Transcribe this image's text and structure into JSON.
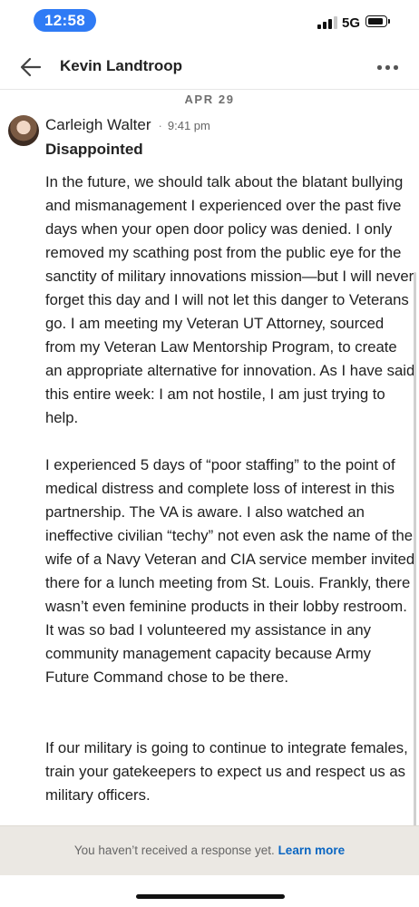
{
  "status_bar": {
    "time": "12:58",
    "network": "5G",
    "signal_bars_active": 3,
    "signal_bars_total": 4,
    "battery_level_fraction": 0.8
  },
  "header": {
    "back_icon": "arrow-left-icon",
    "title": "Kevin Landtroop",
    "more_icon": "more-horizontal-icon"
  },
  "date_divider": "APR 29",
  "message": {
    "sender": "Carleigh Walter",
    "separator": "·",
    "time": "9:41 pm",
    "subject": "Disappointed",
    "paragraphs": [
      "In the future, we should talk about the blatant bullying and mismanagement I experienced over the past five days when your open door policy was denied. I only removed my scathing post from the public eye for the sanctity of military innovations mission—but I will never forget this day and I will not let this danger to Veterans go. I am meeting my Veteran UT Attorney, sourced from my Veteran Law Mentorship Program, to create an appropriate alternative for innovation. As I have said this entire week: I am not hostile, I am just trying to help.",
      "I experienced 5 days of “poor staffing” to the point of medical distress and complete loss of interest in this partnership. The VA is aware. I also watched an ineffective civilian “techy” not even ask the name of the wife of a Navy Veteran and CIA service member invited there for a lunch meeting from St. Louis. Frankly, there wasn’t even feminine products in their lobby restroom. It was so bad I volunteered my assistance in any community management capacity because Army Future Command chose to be there.",
      "If our military is going to continue to integrate females, train your gatekeepers to expect us and respect us as military officers."
    ]
  },
  "footer": {
    "notice": "You haven’t received a response yet.",
    "link": "Learn more"
  },
  "colors": {
    "accent": "#0a66c2",
    "time_pill": "#2f7bf5",
    "footer_bg": "#ebe8e3"
  }
}
